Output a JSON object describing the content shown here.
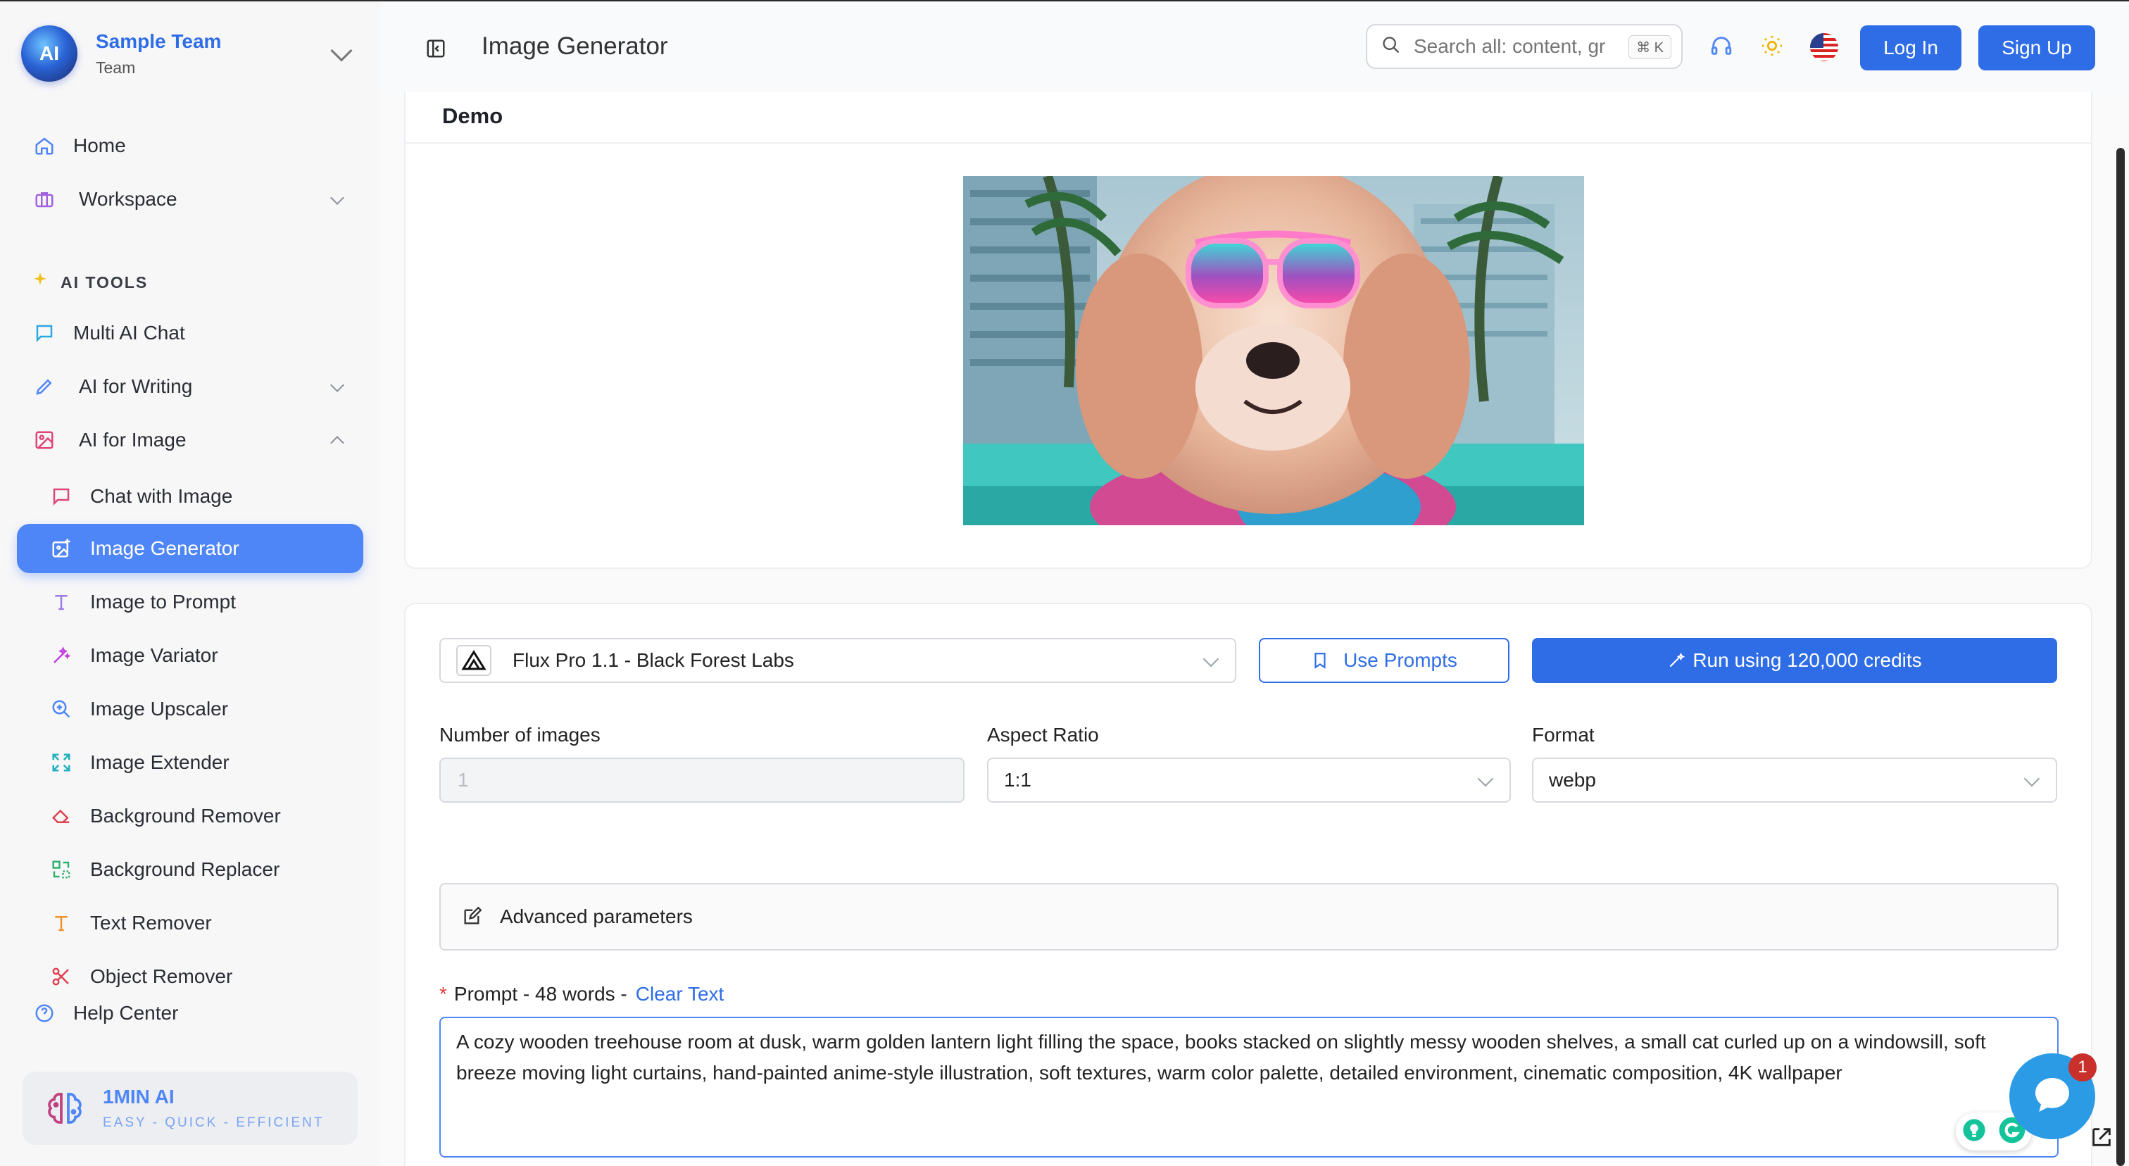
{
  "team": {
    "name": "Sample Team",
    "subtitle": "Team",
    "logo_text": "AI"
  },
  "sidebar": {
    "home": "Home",
    "workspace": "Workspace",
    "section_label": "AI TOOLS",
    "items": [
      {
        "label": "Multi AI Chat"
      },
      {
        "label": "AI for Writing"
      },
      {
        "label": "AI for Image"
      }
    ],
    "sub_items": [
      {
        "label": "Chat with Image"
      },
      {
        "label": "Image Generator"
      },
      {
        "label": "Image to Prompt"
      },
      {
        "label": "Image Variator"
      },
      {
        "label": "Image Upscaler"
      },
      {
        "label": "Image Extender"
      },
      {
        "label": "Background Remover"
      },
      {
        "label": "Background Replacer"
      },
      {
        "label": "Text Remover"
      },
      {
        "label": "Object Remover"
      }
    ],
    "help": "Help Center",
    "brand": {
      "name": "1MIN AI",
      "tagline": "EASY - QUICK - EFFICIENT"
    }
  },
  "header": {
    "title": "Image Generator",
    "search_placeholder": "Search all: content, gr",
    "shortcut": "⌘ K",
    "login": "Log In",
    "signup": "Sign Up"
  },
  "demo": {
    "title": "Demo"
  },
  "form": {
    "model": "Flux Pro 1.1 - Black Forest Labs",
    "use_prompts": "Use Prompts",
    "run": "Run using 120,000 credits",
    "num_images_label": "Number of images",
    "num_images_value": "1",
    "aspect_label": "Aspect Ratio",
    "aspect_value": "1:1",
    "format_label": "Format",
    "format_value": "webp",
    "advanced": "Advanced parameters",
    "prompt_label": "Prompt - 48 words -",
    "required_mark": "*",
    "clear_text": "Clear Text",
    "prompt_value": "A cozy wooden treehouse room at dusk, warm golden lantern light filling the space, books stacked on slightly messy wooden shelves, a small cat curled up on a windowsill, soft breeze moving light curtains, hand-painted anime-style illustration, soft textures, warm color palette, detailed environment, cinematic composition, 4K wallpaper"
  },
  "chat_widget": {
    "badge_count": "1"
  },
  "colors": {
    "primary": "#2f6de6",
    "active_item": "#4f86f7",
    "sidebar_bg": "#f7f7f8"
  }
}
